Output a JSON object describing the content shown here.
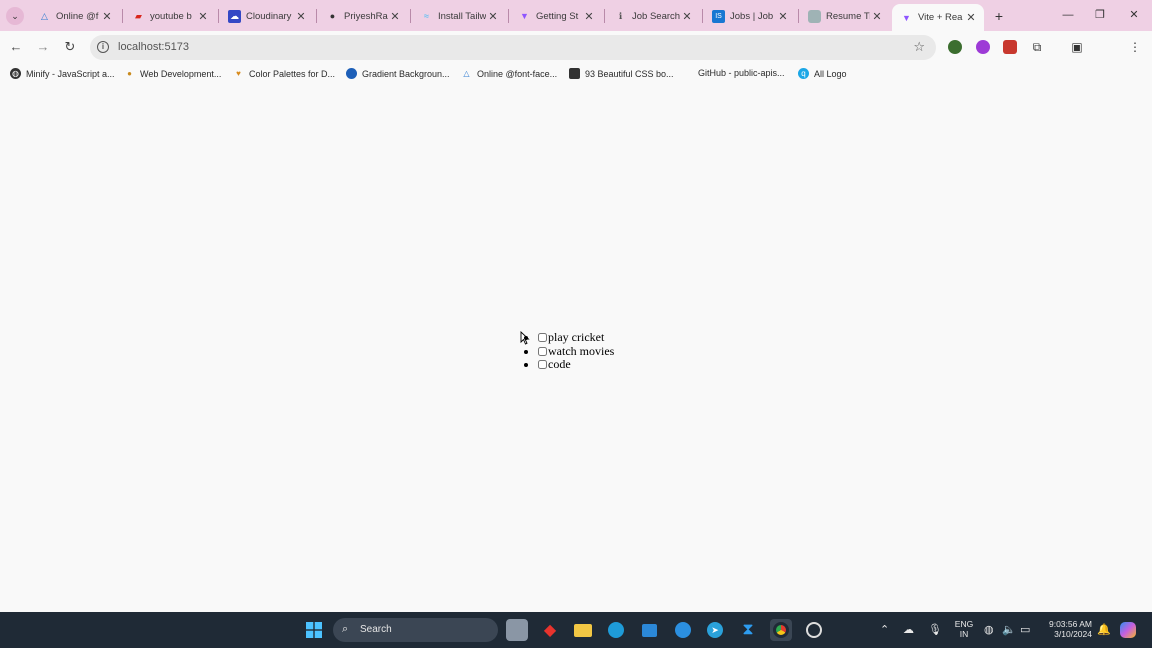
{
  "tabs": [
    {
      "title": "Online @f",
      "icon": "triangle-icon",
      "color": "#2e7bd1"
    },
    {
      "title": "youtube b",
      "icon": "youtube-bookmark-icon",
      "color": "#d9261c"
    },
    {
      "title": "Cloudinary",
      "icon": "cloudinary-icon",
      "color": "#3448c5"
    },
    {
      "title": "PriyeshRai",
      "icon": "github-icon",
      "color": "#333333"
    },
    {
      "title": "Install Tailw",
      "icon": "tailwind-icon",
      "color": "#38bdf8"
    },
    {
      "title": "Getting St",
      "icon": "vite-icon",
      "color": "#8e55ff"
    },
    {
      "title": "Job Search",
      "icon": "info-icon",
      "color": "#555555"
    },
    {
      "title": "Jobs | Job",
      "icon": "is-logo-icon",
      "color": "#1877d2"
    },
    {
      "title": "Resume Tr",
      "icon": "globe-icon",
      "color": "#7a8d8f"
    },
    {
      "title": "Vite + Rea",
      "icon": "vite-icon",
      "color": "#8e55ff"
    }
  ],
  "toolbar": {
    "url": "localhost:5173"
  },
  "bookmarks": [
    {
      "label": "Minify - JavaScript a...",
      "icon": "globe-icon"
    },
    {
      "label": "Web Development...",
      "icon": "dot-icon"
    },
    {
      "label": "Color Palettes for D...",
      "icon": "palette-icon"
    },
    {
      "label": "Gradient Backgroun...",
      "icon": "gradient-icon"
    },
    {
      "label": "Online @font-face...",
      "icon": "triangle-icon"
    },
    {
      "label": "93 Beautiful CSS bo...",
      "icon": "css-icon"
    },
    {
      "label": "GitHub - public-apis...",
      "icon": "none"
    },
    {
      "label": "All Logo",
      "icon": "search-logo-icon"
    }
  ],
  "todos": [
    {
      "label": "play cricket",
      "checked": false
    },
    {
      "label": "watch movies",
      "checked": false
    },
    {
      "label": "code",
      "checked": false
    }
  ],
  "taskbar": {
    "search_label": "Search",
    "lang_top": "ENG",
    "lang_bottom": "IN",
    "time": "9:03:56 AM",
    "date": "3/10/2024"
  }
}
